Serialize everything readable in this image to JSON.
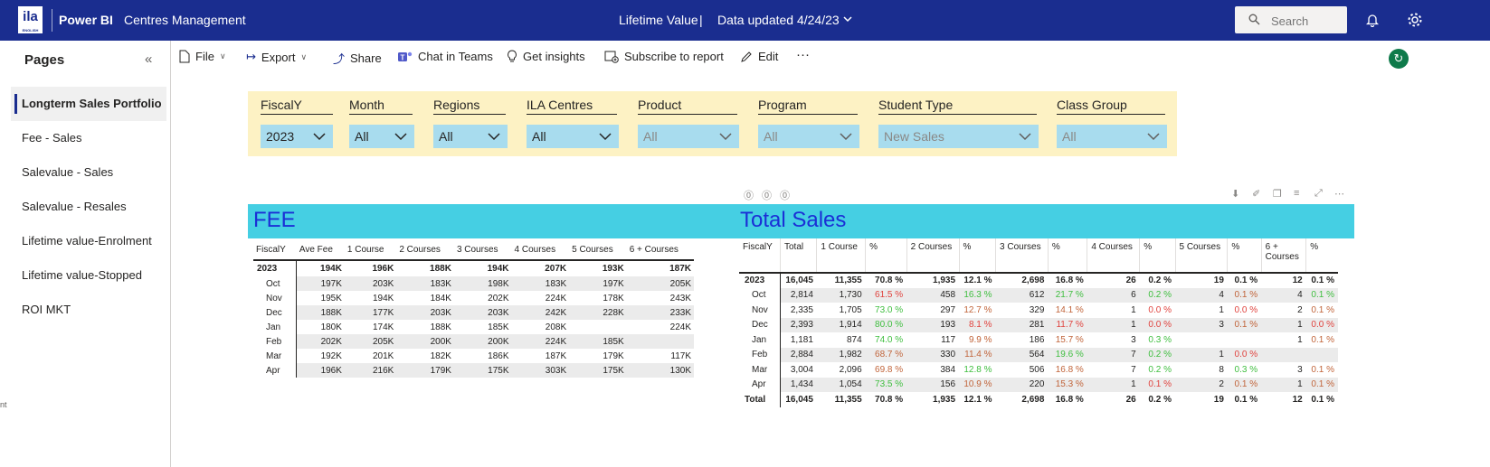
{
  "topbar": {
    "logo_text": "ila",
    "logo_sub": "ENGLISH",
    "app_name": "Power BI",
    "workspace": "Centres Management",
    "report_title": "Lifetime Value",
    "title_sep": "|",
    "data_updated": "Data updated 4/24/23",
    "search_placeholder": "Search"
  },
  "pages": {
    "title": "Pages",
    "items": [
      {
        "label": "Longterm Sales Portfolio"
      },
      {
        "label": "Fee - Sales"
      },
      {
        "label": "Salevalue - Sales"
      },
      {
        "label": "Salevalue - Resales"
      },
      {
        "label": "Lifetime value-Enrolment"
      },
      {
        "label": "Lifetime value-Stopped"
      },
      {
        "label": "ROI MKT"
      }
    ],
    "cut_text": "nt"
  },
  "actions": {
    "file": "File",
    "export": "Export",
    "share": "Share",
    "chat": "Chat in Teams",
    "insights": "Get insights",
    "subscribe": "Subscribe to report",
    "edit": "Edit",
    "more": "···"
  },
  "slicers": [
    {
      "label": "FiscalY",
      "value": "2023",
      "dim": false
    },
    {
      "label": "Month",
      "value": "All",
      "dim": false
    },
    {
      "label": "Regions",
      "value": "All",
      "dim": false
    },
    {
      "label": "ILA Centres",
      "value": "All",
      "dim": false
    },
    {
      "label": "Product",
      "value": "All",
      "dim": true
    },
    {
      "label": "Program",
      "value": "All",
      "dim": true
    },
    {
      "label": "Student Type",
      "value": "New Sales",
      "dim": true
    },
    {
      "label": "Class Group",
      "value": "All",
      "dim": true
    }
  ],
  "fee": {
    "title": "FEE",
    "headers": [
      "FiscalY",
      "Ave Fee",
      "1 Course",
      "2 Courses",
      "3 Courses",
      "4 Courses",
      "5 Courses",
      "6 + Courses"
    ],
    "rows": [
      [
        "2023",
        "194K",
        "196K",
        "188K",
        "194K",
        "207K",
        "193K",
        "187K"
      ],
      [
        "Oct",
        "197K",
        "203K",
        "183K",
        "198K",
        "183K",
        "197K",
        "205K"
      ],
      [
        "Nov",
        "195K",
        "194K",
        "184K",
        "202K",
        "224K",
        "178K",
        "243K"
      ],
      [
        "Dec",
        "188K",
        "177K",
        "203K",
        "203K",
        "242K",
        "228K",
        "233K"
      ],
      [
        "Jan",
        "180K",
        "174K",
        "188K",
        "185K",
        "208K",
        "",
        "224K"
      ],
      [
        "Feb",
        "202K",
        "205K",
        "200K",
        "200K",
        "224K",
        "185K",
        ""
      ],
      [
        "Mar",
        "192K",
        "201K",
        "182K",
        "186K",
        "187K",
        "179K",
        "117K"
      ],
      [
        "Apr",
        "196K",
        "216K",
        "179K",
        "175K",
        "303K",
        "175K",
        "130K"
      ]
    ]
  },
  "total_sales": {
    "title": "Total Sales",
    "headers": [
      "FiscalY",
      "Total",
      "1 Course",
      "%",
      "2 Courses",
      "%",
      "3 Courses",
      "%",
      "4 Courses",
      "%",
      "5 Courses",
      "%",
      "6 + Courses",
      "%"
    ],
    "rows": [
      [
        "2023",
        "16,045",
        "11,355",
        "70.8 %",
        "1,935",
        "12.1 %",
        "2,698",
        "16.8 %",
        "26",
        "0.2 %",
        "19",
        "0.1 %",
        "12",
        "0.1 %"
      ],
      [
        "Oct",
        "2,814",
        "1,730",
        "61.5 %",
        "458",
        "16.3 %",
        "612",
        "21.7 %",
        "6",
        "0.2 %",
        "4",
        "0.1 %",
        "4",
        "0.1 %"
      ],
      [
        "Nov",
        "2,335",
        "1,705",
        "73.0 %",
        "297",
        "12.7 %",
        "329",
        "14.1 %",
        "1",
        "0.0 %",
        "1",
        "0.0 %",
        "2",
        "0.1 %"
      ],
      [
        "Dec",
        "2,393",
        "1,914",
        "80.0 %",
        "193",
        "8.1 %",
        "281",
        "11.7 %",
        "1",
        "0.0 %",
        "3",
        "0.1 %",
        "1",
        "0.0 %"
      ],
      [
        "Jan",
        "1,181",
        "874",
        "74.0 %",
        "117",
        "9.9 %",
        "186",
        "15.7 %",
        "3",
        "0.3 %",
        "",
        "",
        "1",
        "0.1 %"
      ],
      [
        "Feb",
        "2,884",
        "1,982",
        "68.7 %",
        "330",
        "11.4 %",
        "564",
        "19.6 %",
        "7",
        "0.2 %",
        "1",
        "0.0 %",
        "",
        ""
      ],
      [
        "Mar",
        "3,004",
        "2,096",
        "69.8 %",
        "384",
        "12.8 %",
        "506",
        "16.8 %",
        "7",
        "0.2 %",
        "8",
        "0.3 %",
        "3",
        "0.1 %"
      ],
      [
        "Apr",
        "1,434",
        "1,054",
        "73.5 %",
        "156",
        "10.9 %",
        "220",
        "15.3 %",
        "1",
        "0.1 %",
        "2",
        "0.1 %",
        "1",
        "0.1 %"
      ],
      [
        "Total",
        "16,045",
        "11,355",
        "70.8 %",
        "1,935",
        "12.1 %",
        "2,698",
        "16.8 %",
        "26",
        "0.2 %",
        "19",
        "0.1 %",
        "12",
        "0.1 %"
      ]
    ],
    "pct_colors": [
      [
        "",
        "",
        "",
        "",
        "",
        ""
      ],
      [
        "red",
        "green",
        "green",
        "green",
        "amber",
        "green"
      ],
      [
        "green",
        "amber",
        "amber",
        "red",
        "red",
        "amber"
      ],
      [
        "green",
        "red",
        "red",
        "red",
        "amber",
        "red"
      ],
      [
        "green",
        "amber",
        "amber",
        "green",
        "",
        "amber"
      ],
      [
        "amber",
        "amber",
        "green",
        "green",
        "red",
        ""
      ],
      [
        "amber",
        "green",
        "amber",
        "green",
        "green",
        "amber"
      ],
      [
        "green",
        "amber",
        "amber",
        "red",
        "amber",
        "amber"
      ],
      [
        "",
        "",
        "",
        "",
        "",
        ""
      ]
    ]
  },
  "colors": {
    "topbar": "#1a2d8f",
    "slicer_bg": "#fdf2c4",
    "dropdown_bg": "#a8dcee",
    "header_band": "#45cfe3",
    "title_text": "#1b2fd6",
    "red": "#e0433e",
    "green": "#3fbe3f"
  }
}
